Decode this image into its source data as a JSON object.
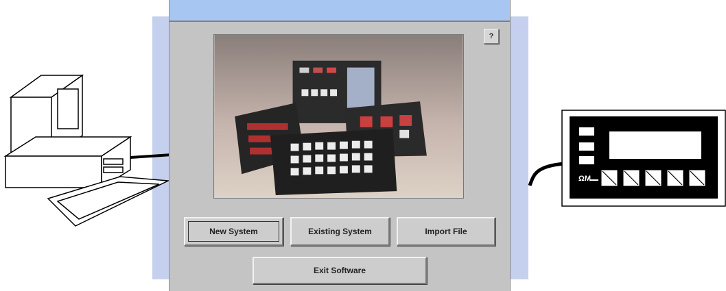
{
  "window": {
    "help_label": "?",
    "buttons": {
      "new_system": "New System",
      "existing_system": "Existing System",
      "import_file": "Import File",
      "exit_software": "Exit Software"
    }
  },
  "device": {
    "port_label": "ΩM"
  },
  "colors": {
    "titlebar": "#a8c6f2",
    "backdrop": "#c5d0ee",
    "window_face": "#c4c4c4"
  }
}
